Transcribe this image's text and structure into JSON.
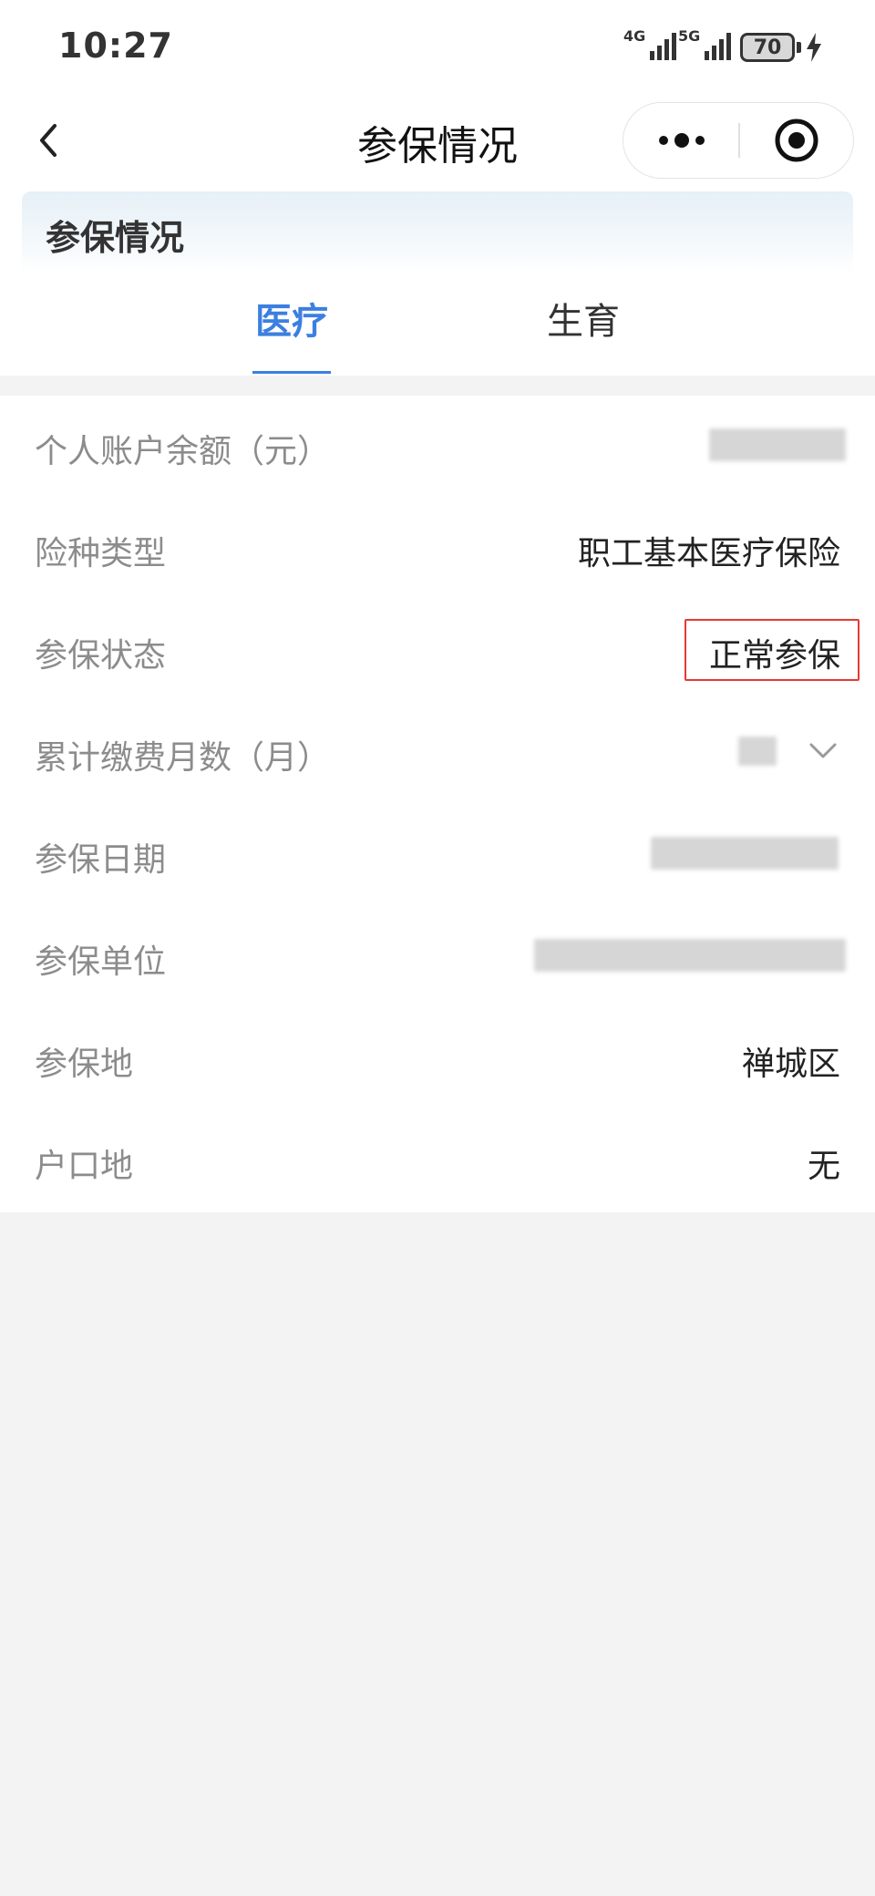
{
  "status_bar": {
    "time": "10:27",
    "network_1": "4G",
    "network_2": "5G",
    "battery": "70",
    "charging_icon": "bolt-icon"
  },
  "nav": {
    "title": "参保情况",
    "back_icon": "chevron-left-icon",
    "more_icon": "more-dots-icon",
    "close_icon": "target-circle-icon"
  },
  "banner": {
    "title": "参保情况"
  },
  "tabs": [
    {
      "label": "医疗",
      "active": true
    },
    {
      "label": "生育",
      "active": false
    }
  ],
  "info": {
    "rows": [
      {
        "label": "个人账户余额（元）",
        "value": "",
        "redacted": true
      },
      {
        "label": "险种类型",
        "value": "职工基本医疗保险"
      },
      {
        "label": "参保状态",
        "value": "正常参保",
        "highlighted": true
      },
      {
        "label": "累计缴费月数（月）",
        "value": "",
        "redacted": true,
        "expand_icon": "chevron-down-icon"
      },
      {
        "label": "参保日期",
        "value": "",
        "redacted": true
      },
      {
        "label": "参保单位",
        "value": "",
        "redacted": true
      },
      {
        "label": "参保地",
        "value": "禅城区"
      },
      {
        "label": "户口地",
        "value": "无"
      }
    ]
  },
  "colors": {
    "accent": "#3c7fe0",
    "highlight_border": "#e53935",
    "label_gray": "#8c8c8c",
    "page_bg": "#f3f3f3"
  }
}
